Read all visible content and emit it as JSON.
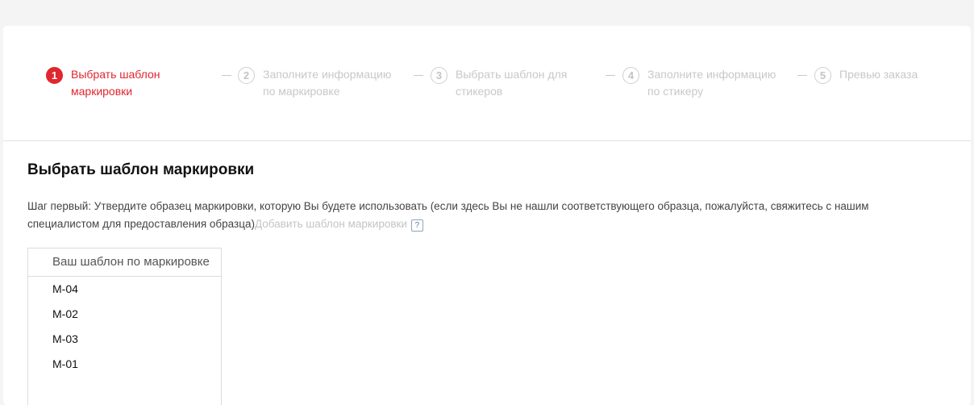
{
  "steps": [
    {
      "num": "1",
      "label": "Выбрать шаблон маркировки",
      "active": true
    },
    {
      "num": "2",
      "label": "Заполните информацию по маркировке",
      "active": false
    },
    {
      "num": "3",
      "label": "Выбрать шаблон для стикеров",
      "active": false
    },
    {
      "num": "4",
      "label": "Заполните информацию по стикеру",
      "active": false
    },
    {
      "num": "5",
      "label": "Превью заказа",
      "active": false
    }
  ],
  "colors": {
    "accent": "#e0262f",
    "inactive": "#c8c8c8"
  },
  "section": {
    "title": "Выбрать шаблон маркировки",
    "description": "Шаг первый: Утвердите образец маркировки, которую Вы будете использовать (если здесь Вы не нашли соответствующего образца, пожалуйста, свяжитесь с нашим специалистом для предоставления образца)",
    "add_link": "Добавить шаблон маркировки",
    "help_icon": "question-icon",
    "help_glyph": "?"
  },
  "templates": {
    "header": "Ваш шаблон по маркировке",
    "items": [
      "M-04",
      "M-02",
      "M-03",
      "M-01"
    ]
  }
}
